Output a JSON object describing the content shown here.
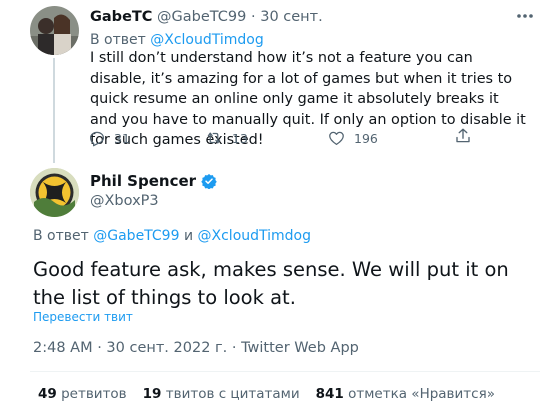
{
  "reply_tweet": {
    "display_name": "GabeTC",
    "handle": "@GabeTC99",
    "separator": "·",
    "date": "30 сент.",
    "reply_prefix": "В ответ",
    "reply_mention": "@XcloudTimdog",
    "text": "I still don’t understand how it’s not a feature you can disable, it’s amazing for a lot of games but when it tries to quick resume an online only game it absolutely breaks it and you have to manually quit. If only an option to disable it for such games existed!",
    "actions": {
      "reply_count": "31",
      "retweet_count": "13",
      "like_count": "196"
    }
  },
  "main_tweet": {
    "display_name": "Phil Spencer",
    "handle": "@XboxP3",
    "verified": true,
    "reply_prefix": "В ответ",
    "reply_mention_1": "@GabeTC99",
    "reply_conj": "и",
    "reply_mention_2": "@XcloudTimdog",
    "text": "Good feature ask, makes sense. We will put it on the list of things to look at.",
    "translate_label": "Перевести твит",
    "timestamp": "2:48 AM · 30 сент. 2022 г. · Twitter Web App",
    "stats": {
      "retweets_count": "49",
      "retweets_label": "ретвитов",
      "quotes_count": "19",
      "quotes_label": "твитов с цитатами",
      "likes_count": "841",
      "likes_label": "отметка «Нравится»"
    }
  },
  "colors": {
    "accent": "#1d9bf0",
    "text_primary": "#0f1419",
    "text_secondary": "#536471",
    "thread_line": "#cfd9de"
  }
}
